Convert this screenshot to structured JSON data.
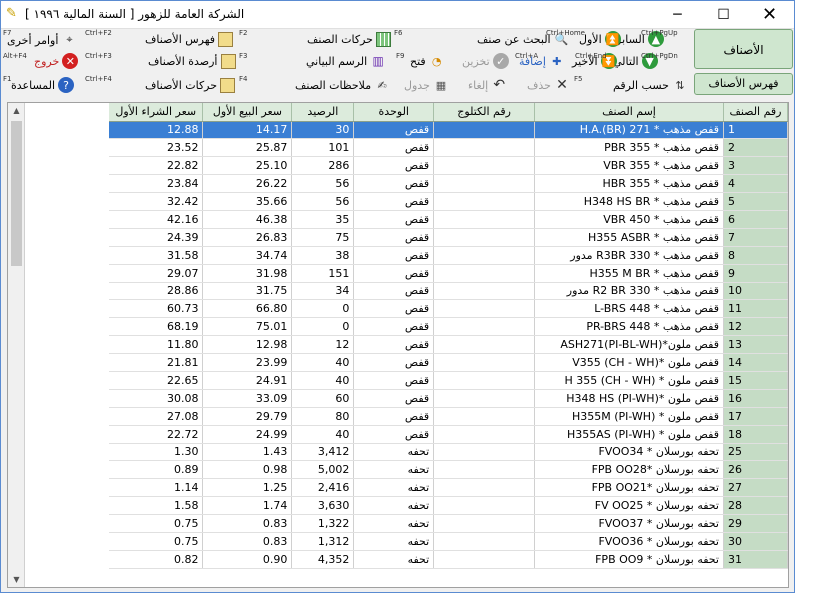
{
  "window": {
    "title": "الشركة العامة للزهور [ السنة المالية ١٩٩٦ ]",
    "controls": {
      "minimize": "─",
      "maximize": "☐",
      "close": "✕"
    }
  },
  "toolbar": {
    "row1": {
      "prev": {
        "label": "السابق",
        "shortcut": "Ctrl+PgUp"
      },
      "first": {
        "label": "الأول"
      },
      "search": {
        "label": "البحث عن صنف",
        "shortcut": "Ctrl+Home"
      },
      "movements": {
        "label": "حركات الصنف",
        "fkey": "F6"
      },
      "catalog": {
        "label": "فهرس الأصناف",
        "fkey": "F2",
        "shortcut": "Ctrl+F2"
      },
      "other_cmds": {
        "label": "أوامر أخرى",
        "fkey": "F7"
      }
    },
    "row2": {
      "next": {
        "label": "التالي",
        "shortcut": "Ctrl+PgDn"
      },
      "last": {
        "label": "الأخير",
        "shortcut": "Ctrl+End"
      },
      "add": {
        "label": "إضافة",
        "shortcut": "Ctrl+A"
      },
      "store": {
        "label": "تخزين"
      },
      "open": {
        "label": "فتح",
        "fkey": "F9"
      },
      "graph": {
        "label": "الرسم البياني"
      },
      "balances": {
        "label": "أرصدة الأصناف",
        "fkey": "F3",
        "shortcut": "Ctrl+F3"
      },
      "exit": {
        "label": "خروج",
        "shortcut": "Alt+F4"
      }
    },
    "row3": {
      "by_number": {
        "label": "حسب الرقم",
        "fkey": "F5"
      },
      "delete": {
        "label": "حذف"
      },
      "undo": {
        "label": "إلغاء"
      },
      "table": {
        "label": "جدول"
      },
      "notes": {
        "label": "ملاحظات الصنف"
      },
      "movements2": {
        "label": "حركات الأصناف",
        "fkey": "F4",
        "shortcut": "Ctrl+F4"
      },
      "help": {
        "label": "المساعدة",
        "fkey": "F1"
      }
    },
    "side": {
      "items_button": "الأصناف",
      "catalog_button": "فهرس الأصناف"
    }
  },
  "grid": {
    "columns": [
      "سعر الشراء الأول",
      "سعر البيع الأول",
      "الرصيد",
      "الوحدة",
      "رقم الكتلوج",
      "إسم الصنف",
      "رقم الصنف"
    ],
    "rows": [
      [
        "12.88",
        "14.17",
        "30",
        "قفص",
        "",
        "قفص مذهب * H.A.(BR) 271",
        "1"
      ],
      [
        "23.52",
        "25.87",
        "101",
        "قفص",
        "",
        "قفص مذهب * PBR 355",
        "2"
      ],
      [
        "22.82",
        "25.10",
        "286",
        "قفص",
        "",
        "قفص مذهب * VBR 355",
        "3"
      ],
      [
        "23.84",
        "26.22",
        "56",
        "قفص",
        "",
        "قفص مذهب * HBR 355",
        "4"
      ],
      [
        "32.42",
        "35.66",
        "56",
        "قفص",
        "",
        "قفص مذهب * H348 HS BR",
        "5"
      ],
      [
        "42.16",
        "46.38",
        "35",
        "قفص",
        "",
        "قفص مذهب * VBR 450",
        "6"
      ],
      [
        "24.39",
        "26.83",
        "75",
        "قفص",
        "",
        "قفص مذهب * H355 ASBR",
        "7"
      ],
      [
        "31.58",
        "34.74",
        "38",
        "قفص",
        "",
        "قفص مذهب * R3BR 330 مدور",
        "8"
      ],
      [
        "29.07",
        "31.98",
        "151",
        "قفص",
        "",
        "قفص مذهب * H355 M BR",
        "9"
      ],
      [
        "28.86",
        "31.75",
        "34",
        "قفص",
        "",
        "قفص مذهب * R2 BR 330 مدور",
        "10"
      ],
      [
        "60.73",
        "66.80",
        "0",
        "قفص",
        "",
        "قفص مذهب * L-BRS 448",
        "11"
      ],
      [
        "68.19",
        "75.01",
        "0",
        "قفص",
        "",
        "قفص مذهب * PR-BRS 448",
        "12"
      ],
      [
        "11.80",
        "12.98",
        "12",
        "قفص",
        "",
        "قفص ملون*(PI-BL-WH)ASH271",
        "13"
      ],
      [
        "21.81",
        "23.99",
        "40",
        "قفص",
        "",
        "قفص ملون *(CH - WH) V355",
        "14"
      ],
      [
        "22.65",
        "24.91",
        "40",
        "قفص",
        "",
        "قفص ملون * (CH - WH) H 355",
        "15"
      ],
      [
        "30.08",
        "33.09",
        "60",
        "قفص",
        "",
        "قفص ملون *(PI-WH) H348 HS",
        "16"
      ],
      [
        "27.08",
        "29.79",
        "80",
        "قفص",
        "",
        "قفص ملون * (PI-WH) H355M",
        "17"
      ],
      [
        "22.72",
        "24.99",
        "40",
        "قفص",
        "",
        "قفص ملون * (PI-WH) H355AS",
        "18"
      ],
      [
        "1.30",
        "1.43",
        "3,412",
        "تحفه",
        "",
        "تحفه بورسلان * FVOO34",
        "25"
      ],
      [
        "0.89",
        "0.98",
        "5,002",
        "تحفه",
        "",
        "تحفه بورسلان *FPB OO28",
        "26"
      ],
      [
        "1.14",
        "1.25",
        "2,416",
        "تحفه",
        "",
        "تحفه بورسلان *FPB OO21",
        "27"
      ],
      [
        "1.58",
        "1.74",
        "3,630",
        "تحفه",
        "",
        "تحفه بورسلان * FV OO25",
        "28"
      ],
      [
        "0.75",
        "0.83",
        "1,322",
        "تحفه",
        "",
        "تحفه بورسلان * FVOO37",
        "29"
      ],
      [
        "0.75",
        "0.83",
        "1,312",
        "تحفه",
        "",
        "تحفه بورسلان * FVOO36",
        "30"
      ],
      [
        "0.82",
        "0.90",
        "4,352",
        "تحفه",
        "",
        "تحفه بورسلان * FPB OO9",
        "31"
      ]
    ],
    "selected_row": 0
  }
}
